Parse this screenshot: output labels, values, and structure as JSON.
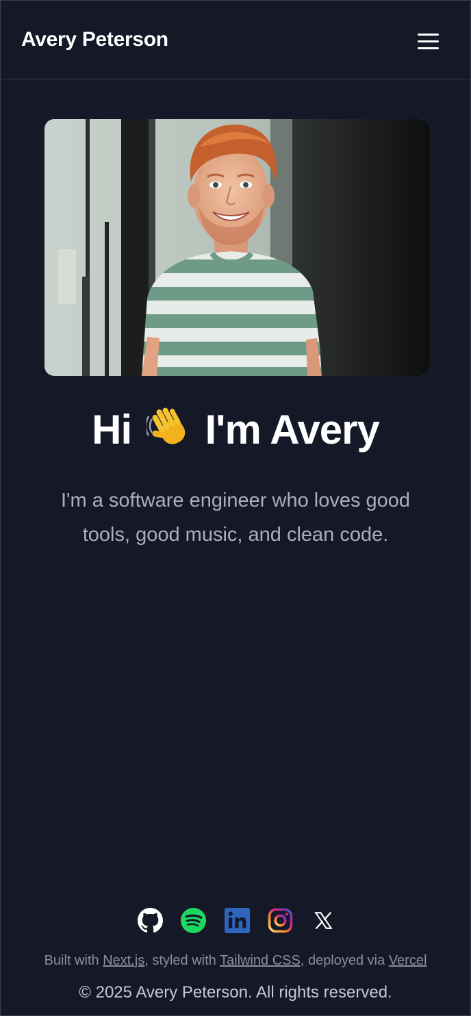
{
  "header": {
    "brand": "Avery Peterson",
    "menu_icon": "hamburger-menu-icon"
  },
  "hero": {
    "photo_icon": "profile-photo",
    "greeting_before": "Hi",
    "greeting_emoji": "waving-hand-icon",
    "greeting_after": "I'm Avery",
    "intro": "I'm a software engineer who loves good tools, good music, and clean code."
  },
  "social": [
    {
      "name": "github",
      "icon": "github-icon"
    },
    {
      "name": "spotify",
      "icon": "spotify-icon",
      "color": "#1ED760"
    },
    {
      "name": "linkedin",
      "icon": "linkedin-icon",
      "color": "#2E64BC"
    },
    {
      "name": "instagram",
      "icon": "instagram-icon",
      "color": "#E1306C"
    },
    {
      "name": "x",
      "icon": "x-icon"
    }
  ],
  "footer": {
    "built_prefix": "Built with",
    "nextjs": "Next.js",
    "styled_text": ", styled with",
    "tailwind": "Tailwind CSS",
    "deployed_text": ", deployed via",
    "vercel": "Vercel",
    "copyright": "© 2025 Avery Peterson. All rights reserved."
  },
  "colors": {
    "background": "#141827",
    "heading": "#FFFFFF",
    "body_text": "#A9B0BD",
    "muted_text": "#8A909C"
  }
}
